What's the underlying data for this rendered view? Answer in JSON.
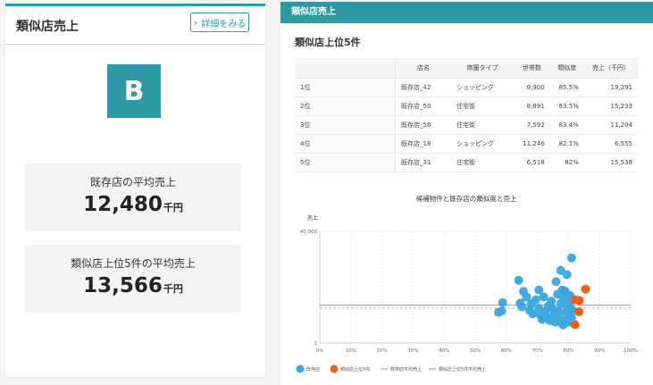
{
  "left_panel": {
    "title": "類似店売上",
    "detail_button": "詳細をみる",
    "grade": "B",
    "existing_avg": {
      "label": "既存店の平均売上",
      "value": "12,480",
      "unit": "千円"
    },
    "top5_avg": {
      "label": "類似店上位5件の平均売上",
      "value": "13,566",
      "unit": "千円"
    }
  },
  "right_panel": {
    "header": "類似店売上",
    "section_title": "類似店上位5件",
    "table": {
      "columns": [
        "",
        "店名",
        "商圏タイプ",
        "世帯数",
        "類似度",
        "売上（千円）"
      ],
      "rows": [
        [
          "1位",
          "既存店_42",
          "ショッピング",
          "9,900",
          "85.5%",
          "19,291"
        ],
        [
          "2位",
          "既存店_50",
          "住宅街",
          "8,891",
          "83.5%",
          "15,233"
        ],
        [
          "3位",
          "既存店_56",
          "住宅街",
          "7,592",
          "83.4%",
          "11,204"
        ],
        [
          "4位",
          "既存店_18",
          "ショッピング",
          "11,246",
          "82.1%",
          "6,555"
        ],
        [
          "5位",
          "既存店_31",
          "住宅街",
          "6,518",
          "82%",
          "15,538"
        ]
      ]
    }
  },
  "chart_data": {
    "type": "scatter",
    "title": "候補物件と既存店の類似度と売上",
    "ylabel": "売上",
    "xlabel": "",
    "xlim": [
      0,
      100
    ],
    "ylim": [
      0,
      40000
    ],
    "x_ticks": [
      "0%",
      "10%",
      "20%",
      "30%",
      "40%",
      "50%",
      "60%",
      "70%",
      "80%",
      "90%",
      "100%"
    ],
    "y_ticks": [
      "0",
      "40,000"
    ],
    "grid": "vertical",
    "legend_position": "bottom-left",
    "legend": [
      "既存店",
      "類似店上位5件",
      "既存店平均売上",
      "類似店上位5件平均売上"
    ],
    "colors": {
      "existing": "#3aa6dd",
      "top5": "#ef5f1a",
      "existing_avg": "#8ba6c8",
      "top5_avg": "#ef7a3a"
    },
    "lines": {
      "existing_avg": 12480,
      "top5_avg": 13566
    },
    "series": [
      {
        "name": "既存店",
        "points": [
          [
            57.5,
            11000
          ],
          [
            58.5,
            11500
          ],
          [
            58.8,
            14500
          ],
          [
            64,
            22500
          ],
          [
            64.5,
            14300
          ],
          [
            65,
            13000
          ],
          [
            65.5,
            18500
          ],
          [
            66.5,
            16500
          ],
          [
            67.5,
            11700
          ],
          [
            68,
            14000
          ],
          [
            68.5,
            10500
          ],
          [
            69.5,
            15500
          ],
          [
            70.5,
            19000
          ],
          [
            70.5,
            12500
          ],
          [
            71,
            10000
          ],
          [
            71.5,
            8500
          ],
          [
            72,
            16500
          ],
          [
            72.5,
            11200
          ],
          [
            73,
            9500
          ],
          [
            73.5,
            13200
          ],
          [
            74,
            8000
          ],
          [
            74.5,
            15000
          ],
          [
            75,
            12200
          ],
          [
            75.5,
            10500
          ],
          [
            75.8,
            7500
          ],
          [
            76,
            22000
          ],
          [
            76.5,
            17500
          ],
          [
            76.8,
            11500
          ],
          [
            77,
            9000
          ],
          [
            77.5,
            14200
          ],
          [
            78,
            19000
          ],
          [
            78.2,
            6500
          ],
          [
            78.5,
            16000
          ],
          [
            79,
            8000
          ],
          [
            79.2,
            11000
          ],
          [
            79.5,
            13500
          ],
          [
            79.8,
            17200
          ],
          [
            80,
            7500
          ],
          [
            80.2,
            10200
          ],
          [
            80.5,
            14800
          ],
          [
            80.8,
            12300
          ],
          [
            81,
            9000
          ],
          [
            81,
            30500
          ],
          [
            79.5,
            24500
          ],
          [
            77.5,
            26000
          ],
          [
            79,
            18500
          ],
          [
            80.5,
            17000
          ],
          [
            81.5,
            11500
          ]
        ]
      },
      {
        "name": "類似店上位5件",
        "points": [
          [
            85.5,
            19291
          ],
          [
            83.5,
            15233
          ],
          [
            83.4,
            11204
          ],
          [
            82.1,
            6555
          ],
          [
            82,
            15538
          ]
        ]
      }
    ]
  }
}
